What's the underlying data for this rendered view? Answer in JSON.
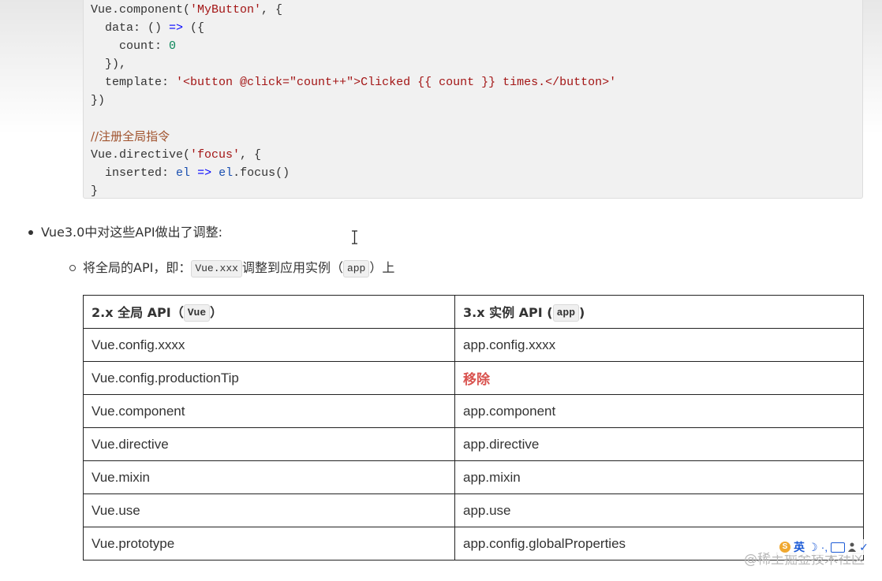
{
  "code": {
    "lines": [
      [
        {
          "t": "Vue.component(",
          "c": ""
        },
        {
          "t": "'MyButton'",
          "c": "str"
        },
        {
          "t": ", {",
          "c": ""
        }
      ],
      [
        {
          "t": "  data: () ",
          "c": ""
        },
        {
          "t": "=>",
          "c": "arrow"
        },
        {
          "t": " ({",
          "c": ""
        }
      ],
      [
        {
          "t": "    count: ",
          "c": ""
        },
        {
          "t": "0",
          "c": "num"
        }
      ],
      [
        {
          "t": "  }),",
          "c": ""
        }
      ],
      [
        {
          "t": "  template: ",
          "c": ""
        },
        {
          "t": "'<button @click=\"count++\">Clicked {{ count }} times.</button>'",
          "c": "str"
        }
      ],
      [
        {
          "t": "})",
          "c": ""
        }
      ],
      [
        {
          "t": "",
          "c": ""
        }
      ],
      [
        {
          "t": "//注册全局指令",
          "c": "cmt"
        }
      ],
      [
        {
          "t": "Vue.directive(",
          "c": ""
        },
        {
          "t": "'focus'",
          "c": "str"
        },
        {
          "t": ", {",
          "c": ""
        }
      ],
      [
        {
          "t": "  inserted: ",
          "c": ""
        },
        {
          "t": "el",
          "c": "var"
        },
        {
          "t": " ",
          "c": ""
        },
        {
          "t": "=>",
          "c": "arrow"
        },
        {
          "t": " ",
          "c": ""
        },
        {
          "t": "el",
          "c": "var"
        },
        {
          "t": ".focus()",
          "c": ""
        }
      ],
      [
        {
          "t": "}",
          "c": ""
        }
      ]
    ]
  },
  "bullet": {
    "text": "Vue3.0中对这些API做出了调整:"
  },
  "sub_bullet": {
    "prefix": "将全局的API，即：",
    "code1": "Vue.xxx",
    "middle": "调整到应用实例（",
    "code2": "app",
    "suffix": "）上"
  },
  "table": {
    "header": {
      "col1_prefix": "2.x 全局 API（",
      "col1_code": "Vue",
      "col1_suffix": "）",
      "col2_prefix": "3.x 实例 API (",
      "col2_code": "app",
      "col2_suffix": ")"
    },
    "rows": [
      {
        "v2": "Vue.config.xxxx",
        "v3": "app.config.xxxx",
        "removed": false
      },
      {
        "v2": "Vue.config.productionTip",
        "v3": "移除",
        "removed": true
      },
      {
        "v2": "Vue.component",
        "v3": "app.component",
        "removed": false
      },
      {
        "v2": "Vue.directive",
        "v3": "app.directive",
        "removed": false
      },
      {
        "v2": "Vue.mixin",
        "v3": "app.mixin",
        "removed": false
      },
      {
        "v2": "Vue.use",
        "v3": "app.use",
        "removed": false
      },
      {
        "v2": "Vue.prototype",
        "v3": "app.config.globalProperties",
        "removed": false
      }
    ]
  },
  "watermark": "@稀土掘金技术社区",
  "ime": {
    "logo": "S",
    "lang": "英",
    "moon": "☽",
    "dot": "·,",
    "more": "✓"
  }
}
